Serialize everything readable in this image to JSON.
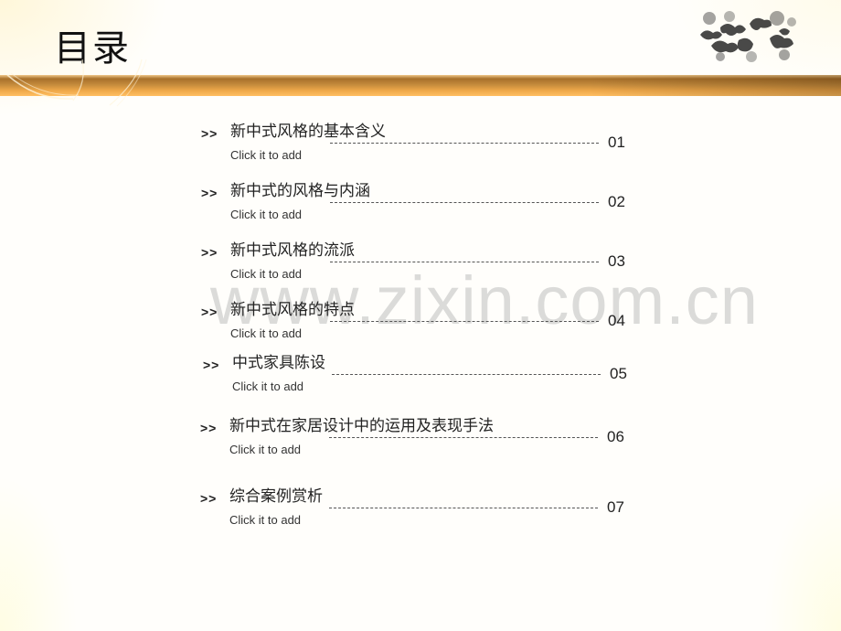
{
  "page": {
    "title": "目录",
    "watermark": "www.zixin.com.cn",
    "colors": {
      "accent_bar": "#e9a545",
      "text": "#222222",
      "background": "#fffefb"
    }
  },
  "decor": {
    "cloud_icon": "auspicious-cloud-pattern"
  },
  "toc": {
    "arrow": ">>",
    "items": [
      {
        "title": "新中式风格的基本含义",
        "subtitle": "Click it to add",
        "number": "01"
      },
      {
        "title": "新中式的风格与内涵",
        "subtitle": "Click it to add",
        "number": "02"
      },
      {
        "title": "新中式风格的流派",
        "subtitle": "Click it to add",
        "number": "03"
      },
      {
        "title": "新中式风格的特点",
        "subtitle": "Click it to add",
        "number": "04"
      },
      {
        "title": "中式家具陈设",
        "subtitle": "Click it to add",
        "number": "05"
      },
      {
        "title": "新中式在家居设计中的运用及表现手法",
        "subtitle": "Click it to add",
        "number": "06"
      },
      {
        "title": "综合案例赏析",
        "subtitle": "Click it to add",
        "number": "07"
      }
    ]
  }
}
